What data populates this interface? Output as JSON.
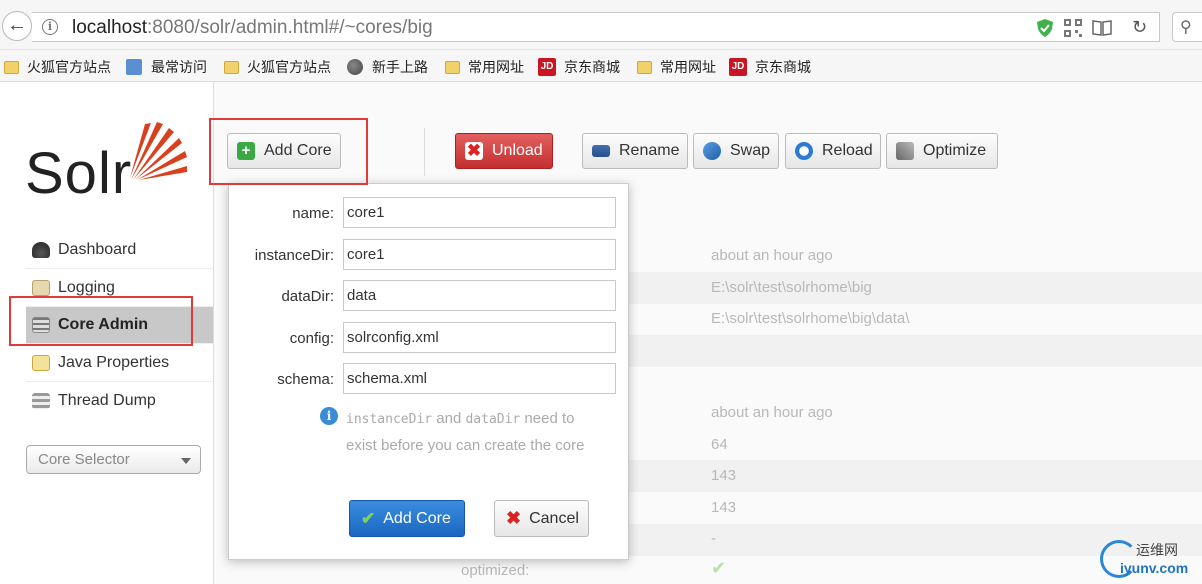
{
  "browser": {
    "url_host": "localhost",
    "url_rest": ":8080/solr/admin.html#/~cores/big",
    "bookmarks": [
      {
        "label": "火狐官方站点",
        "icon": "folder-icon"
      },
      {
        "label": "最常访问",
        "icon": "search-doc-icon"
      },
      {
        "label": "火狐官方站点",
        "icon": "folder-icon"
      },
      {
        "label": "新手上路",
        "icon": "globe-icon"
      },
      {
        "label": "常用网址",
        "icon": "folder-icon"
      },
      {
        "label": "京东商城",
        "icon": "jd-icon"
      },
      {
        "label": "常用网址",
        "icon": "folder-icon"
      },
      {
        "label": "京东商城",
        "icon": "jd-icon"
      }
    ],
    "jd_badge": "JD"
  },
  "logo": {
    "text": "Solr"
  },
  "sidebar": {
    "items": [
      {
        "label": "Dashboard",
        "icon": "dashboard-icon"
      },
      {
        "label": "Logging",
        "icon": "logging-icon"
      },
      {
        "label": "Core Admin",
        "icon": "core-admin-icon",
        "active": true
      },
      {
        "label": "Java Properties",
        "icon": "java-properties-icon"
      },
      {
        "label": "Thread Dump",
        "icon": "thread-dump-icon"
      }
    ],
    "core_selector": "Core Selector"
  },
  "toolbar": {
    "add_core": "Add Core",
    "unload": "Unload",
    "rename": "Rename",
    "swap": "Swap",
    "reload": "Reload",
    "optimize": "Optimize"
  },
  "core_info": {
    "values": [
      "about an hour ago",
      "E:\\solr\\test\\solrhome\\big",
      "E:\\solr\\test\\solrhome\\big\\data\\",
      "about an hour ago",
      "64",
      "143",
      "143",
      "-"
    ],
    "optimized_label": "optimized:"
  },
  "popup": {
    "fields": [
      {
        "label": "name:",
        "value": "core1"
      },
      {
        "label": "instanceDir:",
        "value": "core1"
      },
      {
        "label": "dataDir:",
        "value": "data"
      },
      {
        "label": "config:",
        "value": "solrconfig.xml"
      },
      {
        "label": "schema:",
        "value": "schema.xml"
      }
    ],
    "hint_code1": "instanceDir",
    "hint_and": " and ",
    "hint_code2": "dataDir",
    "hint_rest": " need to exist before you can create the core",
    "add_core": "Add Core",
    "cancel": "Cancel"
  },
  "watermark": {
    "line1": "运维网",
    "line2": "iyunv.com"
  },
  "colors": {
    "accent": "#1a66c0",
    "unload": "#c42f2f",
    "highlight": "#e03a3a"
  }
}
